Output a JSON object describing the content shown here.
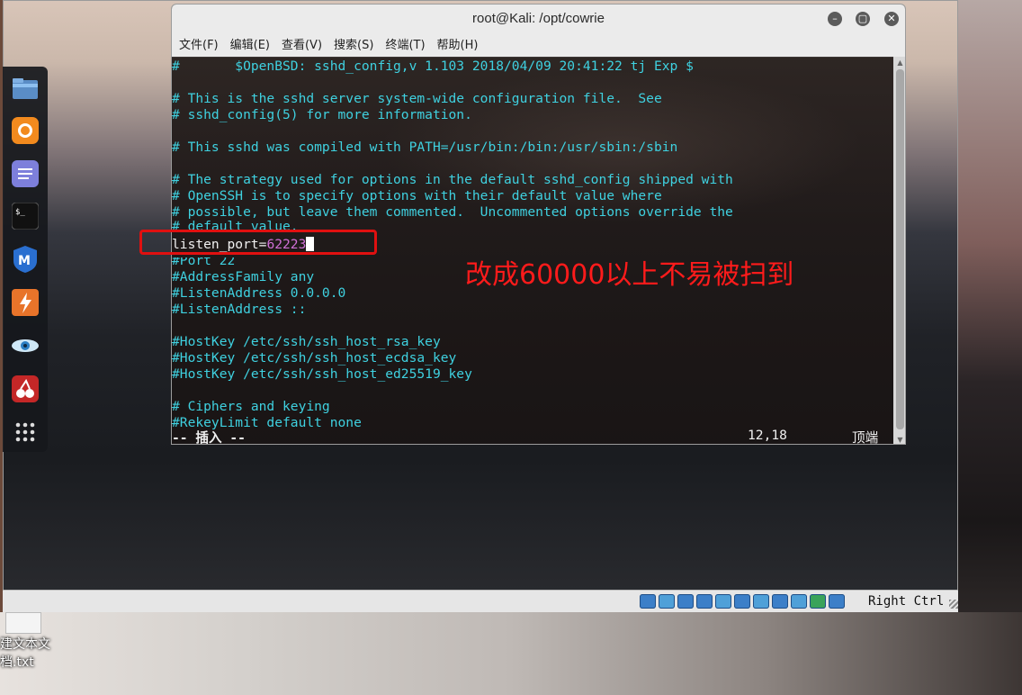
{
  "window": {
    "title": "root@Kali: /opt/cowrie",
    "controls": [
      "minimize-icon",
      "maximize-icon",
      "close-icon"
    ]
  },
  "menubar": [
    "文件(F)",
    "编辑(E)",
    "查看(V)",
    "搜索(S)",
    "终端(T)",
    "帮助(H)"
  ],
  "terminal": {
    "lines": [
      "#       $OpenBSD: sshd_config,v 1.103 2018/04/09 20:41:22 tj Exp $",
      "",
      "# This is the sshd server system-wide configuration file.  See",
      "# sshd_config(5) for more information.",
      "",
      "# This sshd was compiled with PATH=/usr/bin:/bin:/usr/sbin:/sbin",
      "",
      "# The strategy used for options in the default sshd_config shipped with",
      "# OpenSSH is to specify options with their default value where",
      "# possible, but leave them commented.  Uncommented options override the",
      "# default value."
    ],
    "edited_line_key": "listen_port=",
    "edited_line_value": "62223",
    "lines_after": [
      "#Port 22",
      "#AddressFamily any",
      "#ListenAddress 0.0.0.0",
      "#ListenAddress ::",
      "",
      "#HostKey /etc/ssh/ssh_host_rsa_key",
      "#HostKey /etc/ssh/ssh_host_ecdsa_key",
      "#HostKey /etc/ssh/ssh_host_ed25519_key",
      "",
      "# Ciphers and keying",
      "#RekeyLimit default none"
    ],
    "status_mode": "-- 插入 --",
    "status_position": "12,18",
    "status_scroll": "顶端"
  },
  "annotation": "改成60000以上不易被扫到",
  "vm_statusbar": {
    "host_key": "Right Ctrl"
  },
  "dock": [
    "files-icon",
    "firefox-icon",
    "text-editor-icon",
    "terminal-icon",
    "metasploit-icon",
    "burpsuite-icon",
    "eye-icon",
    "cherry-icon",
    "app-grid-icon"
  ],
  "desktop_file": {
    "label_line1": "建文本文",
    "label_line2": "档.txt"
  }
}
